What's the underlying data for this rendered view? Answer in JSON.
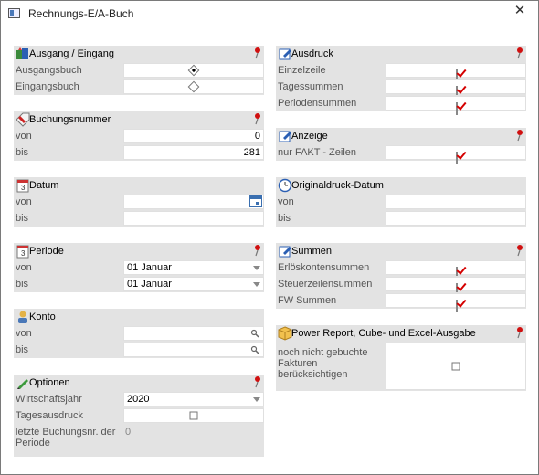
{
  "window": {
    "title": "Rechnungs-E/A-Buch",
    "close_label": "✕"
  },
  "ausgang_eingang": {
    "title": "Ausgang / Eingang",
    "rows": [
      {
        "label": "Ausgangsbuch",
        "selected": true
      },
      {
        "label": "Eingangsbuch",
        "selected": false
      }
    ]
  },
  "buchungsnummer": {
    "title": "Buchungsnummer",
    "von_label": "von",
    "von_value": "0",
    "bis_label": "bis",
    "bis_value": "281"
  },
  "datum": {
    "title": "Datum",
    "von_label": "von",
    "von_value": "",
    "bis_label": "bis",
    "bis_value": ""
  },
  "periode": {
    "title": "Periode",
    "von_label": "von",
    "von_value": "01 Januar",
    "bis_label": "bis",
    "bis_value": "01 Januar"
  },
  "konto": {
    "title": "Konto",
    "von_label": "von",
    "von_value": "",
    "bis_label": "bis",
    "bis_value": ""
  },
  "optionen": {
    "title": "Optionen",
    "wirtschaftsjahr_label": "Wirtschaftsjahr",
    "wirtschaftsjahr_value": "2020",
    "tagesausdruck_label": "Tagesausdruck",
    "tagesausdruck_checked": false,
    "letzte_label": "letzte Buchungsnr. der Periode",
    "letzte_value": "0"
  },
  "ausdruck": {
    "title": "Ausdruck",
    "rows": [
      {
        "label": "Einzelzeile",
        "checked": true
      },
      {
        "label": "Tagessummen",
        "checked": true
      },
      {
        "label": "Periodensummen",
        "checked": true
      }
    ]
  },
  "anzeige": {
    "title": "Anzeige",
    "rows": [
      {
        "label": "nur FAKT - Zeilen",
        "checked": true
      }
    ]
  },
  "originaldruck": {
    "title": "Originaldruck-Datum",
    "von_label": "von",
    "von_value": "",
    "bis_label": "bis",
    "bis_value": ""
  },
  "summen": {
    "title": "Summen",
    "rows": [
      {
        "label": "Erlöskontensummen",
        "checked": true
      },
      {
        "label": "Steuerzeilensummen",
        "checked": true
      },
      {
        "label": "FW Summen",
        "checked": true
      }
    ]
  },
  "power_report": {
    "title": "Power Report, Cube- und Excel-Ausgabe",
    "row_label": "noch nicht gebuchte Fakturen berücksichtigen",
    "checked": false
  },
  "colors": {
    "group_bg": "#e3e3e3",
    "check_red": "#d40000",
    "calendar_blue": "#3a6fb0"
  }
}
